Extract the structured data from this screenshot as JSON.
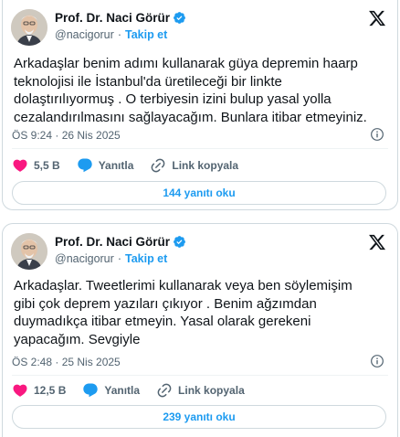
{
  "tweets": [
    {
      "author": {
        "name": "Prof. Dr. Naci Görür",
        "handle": "@nacigorur",
        "follow_label": "Takip et"
      },
      "text": "Arkadaşlar benim adımı kullanarak güya depremin haarp\nteknolojisi ile İstanbul'da üretileceği bir linkte\ndolaştırılıyormuş . O terbiyesin izini bulup yasal yolla\ncezalandırılmasını sağlayacağım. Bunlara itibar etmeyiniz.",
      "timestamp": "ÖS 9:24 · 26 Nis 2025",
      "likes": "5,5 B",
      "reply_label": "Yanıtla",
      "copy_link_label": "Link kopyala",
      "read_replies_label": "144 yanıtı oku"
    },
    {
      "author": {
        "name": "Prof. Dr. Naci Görür",
        "handle": "@nacigorur",
        "follow_label": "Takip et"
      },
      "text": "Arkadaşlar. Tweetlerimi kullanarak veya ben söylemişim\ngibi çok deprem yazıları çıkıyor . Benim ağzımdan\nduymadıkça itibar etmeyin. Yasal olarak gerekeni\nyapacağım. Sevgiyle",
      "timestamp": "ÖS 2:48 · 25 Nis 2025",
      "likes": "12,5 B",
      "reply_label": "Yanıtla",
      "copy_link_label": "Link kopyala",
      "read_replies_label": "239 yanıtı oku"
    }
  ],
  "icons": {
    "verified": "verified-badge-icon",
    "platform": "x-logo-icon",
    "like": "heart-icon",
    "reply": "speech-bubble-icon",
    "copy": "link-icon",
    "info": "info-icon"
  },
  "colors": {
    "accent": "#1d9bf0",
    "like": "#f91880",
    "text": "#0f1419",
    "muted": "#536471",
    "border": "#cfd9de"
  }
}
